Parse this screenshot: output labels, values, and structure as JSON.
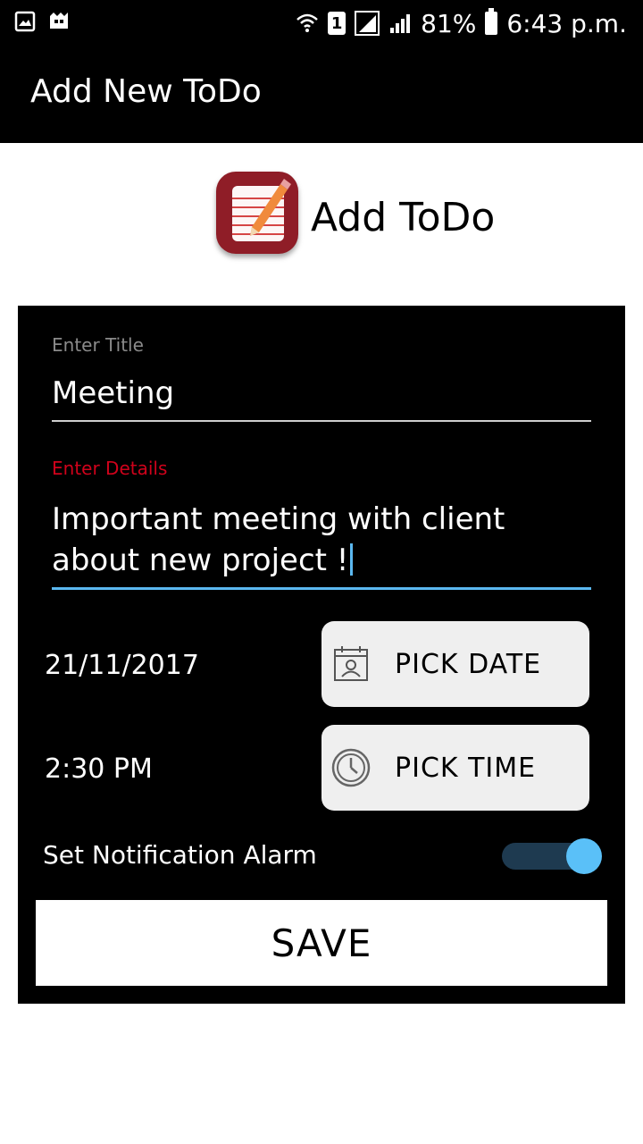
{
  "status_bar": {
    "battery": "81%",
    "time": "6:43 p.m.",
    "sim_slot": "1",
    "icons": [
      "gallery-icon",
      "notification-app-icon",
      "wifi-icon",
      "sim-icon",
      "signal-icon",
      "signal-icon",
      "battery-icon"
    ]
  },
  "app_bar": {
    "title": "Add New ToDo"
  },
  "header": {
    "title": "Add ToDo",
    "logo_icon": "notepad-pencil-icon"
  },
  "form": {
    "title_label": "Enter Title",
    "title_value": "Meeting",
    "details_label": "Enter Details",
    "details_value": "Important meeting with client about new project !",
    "date_value": "21/11/2017",
    "pick_date_label": "PICK DATE",
    "pick_date_icon": "calendar-icon",
    "time_value": "2:30 PM",
    "pick_time_label": "PICK TIME",
    "pick_time_icon": "clock-icon",
    "alarm_label": "Set Notification Alarm",
    "alarm_on": true,
    "save_label": "SAVE"
  },
  "colors": {
    "accent": "#5bb8f0",
    "error_label": "#d0021b",
    "logo_bg": "#8f1d27"
  }
}
